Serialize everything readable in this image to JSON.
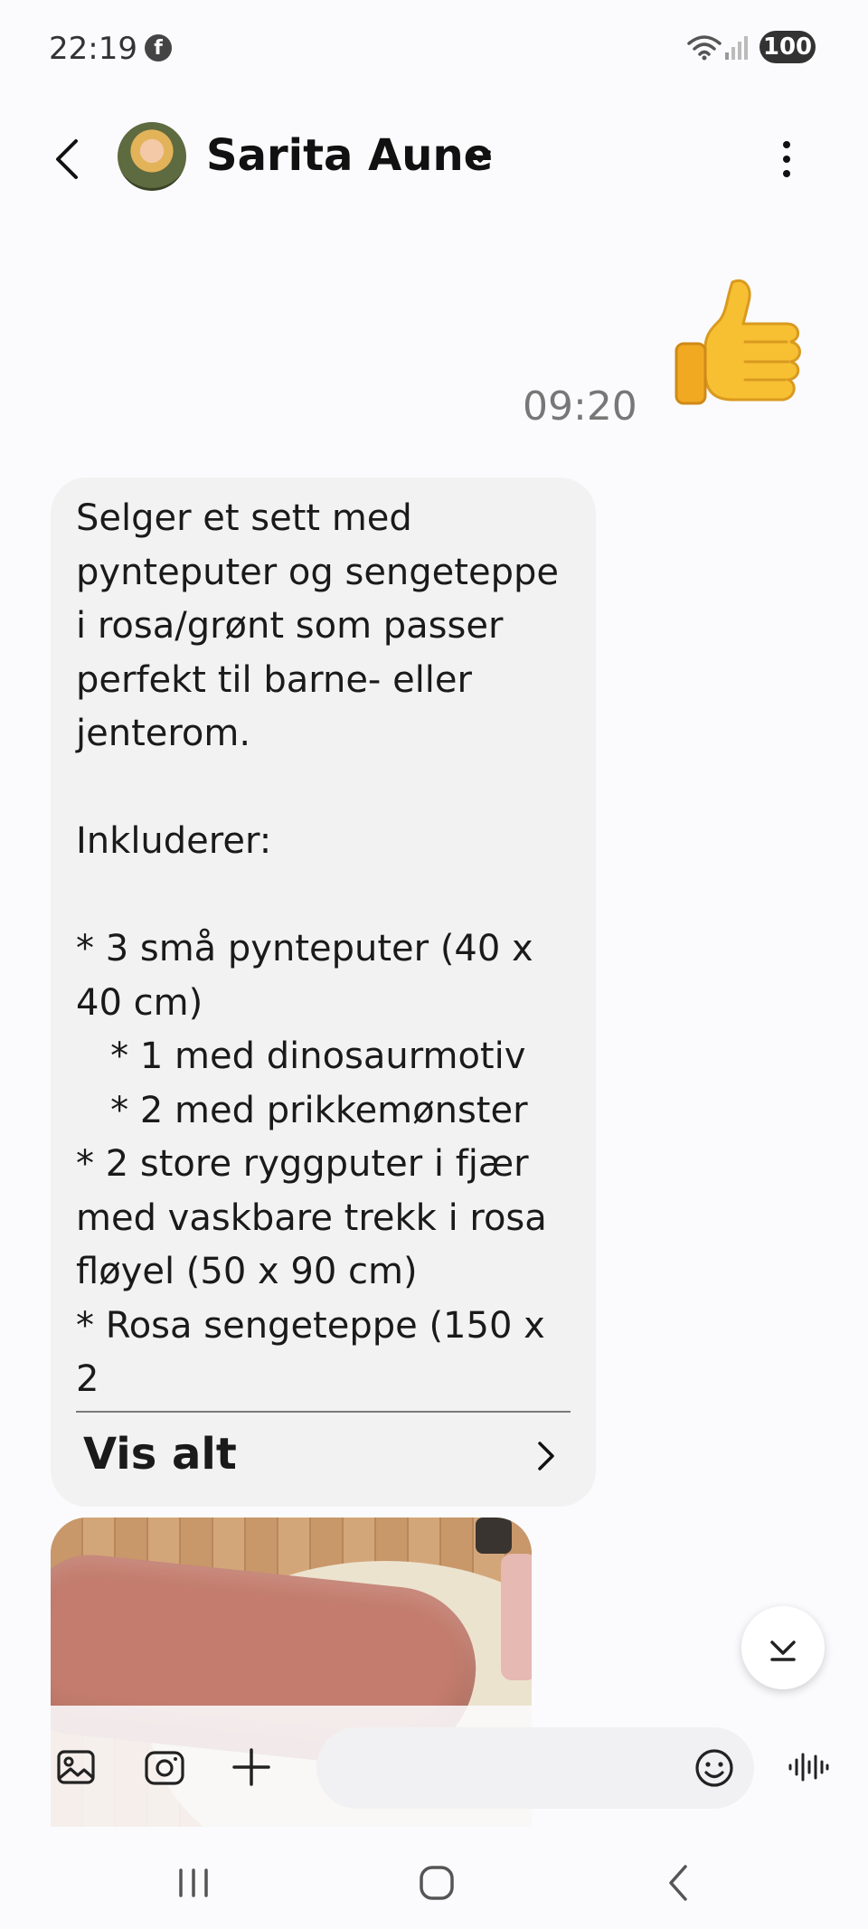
{
  "status_bar": {
    "time": "22:19",
    "battery": "100",
    "notification_icons": [
      "facebook-icon"
    ],
    "system_icons": [
      "wifi-icon",
      "signal-icon",
      "battery-icon"
    ]
  },
  "header": {
    "contact_name": "Sarita Aune",
    "icons": [
      "back-icon",
      "avatar",
      "chevron-down-icon",
      "more-vertical-icon"
    ]
  },
  "messages": [
    {
      "direction": "sent",
      "type": "emoji",
      "content": "👍",
      "time": "09:20"
    },
    {
      "direction": "received",
      "type": "text",
      "text": "Selger et sett med\npynteputer og sengeteppe\ni rosa/grønt som passer\nperfekt til barne- eller\njenterom.\n\nInkluderer:\n\n* 3 små pynteputer (40 x\n40 cm)\n   * 1 med dinosaurmotiv\n   * 2 med prikkemønster\n* 2 store ryggputer i fjær\nmed vaskbare trekk i rosa\nfløyel (50 x 90 cm)\n* Rosa sengeteppe (150 x\n2",
      "show_all_label": "Vis alt"
    },
    {
      "direction": "received",
      "type": "image"
    }
  ],
  "composer": {
    "input_value": "",
    "placeholder": "",
    "icons": [
      "gallery-icon",
      "camera-icon",
      "plus-icon",
      "emoji-icon",
      "voice-icon"
    ]
  },
  "nav_bar": {
    "icons": [
      "recent-apps-icon",
      "home-icon",
      "back-icon"
    ]
  },
  "colors": {
    "background": "#fbfbfd",
    "bubble_received": "#f2f2f2",
    "text": "#111111",
    "muted": "#777777"
  }
}
